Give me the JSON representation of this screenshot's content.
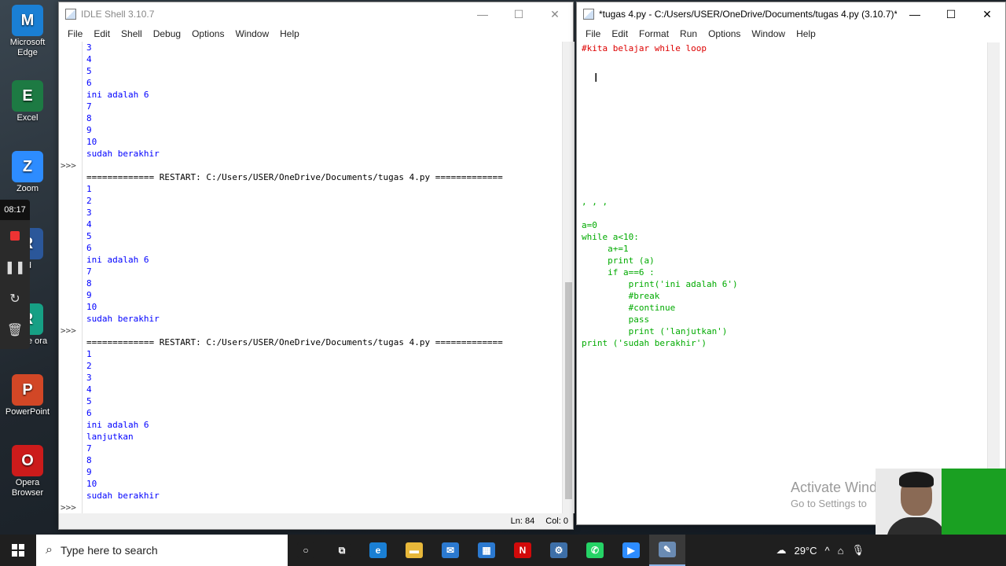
{
  "desktop": {
    "icons": [
      {
        "label": "Microsoft Edge",
        "icon": "edge-icon",
        "color": "#1a7fd4"
      },
      {
        "label": "Excel",
        "icon": "excel-icon",
        "color": "#1d7a43"
      },
      {
        "label": "Zoom",
        "icon": "zoom-icon",
        "color": "#2d8cff"
      },
      {
        "label": "rd",
        "icon": "word-icon",
        "color": "#2b579a"
      },
      {
        "label": "rshare ora",
        "icon": "filmora-icon",
        "color": "#16a085"
      },
      {
        "label": "PowerPoint",
        "icon": "powerpoint-icon",
        "color": "#d24726"
      },
      {
        "label": "Opera Browser",
        "icon": "opera-icon",
        "color": "#cc1b1b"
      }
    ],
    "recorder_time": "08:17"
  },
  "shell": {
    "title": "IDLE Shell 3.10.7",
    "menu": [
      "File",
      "Edit",
      "Shell",
      "Debug",
      "Options",
      "Window",
      "Help"
    ],
    "lines": [
      {
        "p": "",
        "t": "3",
        "k": "out"
      },
      {
        "p": "",
        "t": "4",
        "k": "out"
      },
      {
        "p": "",
        "t": "5",
        "k": "out"
      },
      {
        "p": "",
        "t": "6",
        "k": "out"
      },
      {
        "p": "",
        "t": "ini adalah 6",
        "k": "out"
      },
      {
        "p": "",
        "t": "7",
        "k": "out"
      },
      {
        "p": "",
        "t": "8",
        "k": "out"
      },
      {
        "p": "",
        "t": "9",
        "k": "out"
      },
      {
        "p": "",
        "t": "10",
        "k": "out"
      },
      {
        "p": "",
        "t": "sudah berakhir",
        "k": "out"
      },
      {
        "p": ">>>",
        "t": "",
        "k": "out"
      },
      {
        "p": "",
        "t": "============= RESTART: C:/Users/USER/OneDrive/Documents/tugas 4.py =============",
        "k": "restart"
      },
      {
        "p": "",
        "t": "1",
        "k": "out"
      },
      {
        "p": "",
        "t": "2",
        "k": "out"
      },
      {
        "p": "",
        "t": "3",
        "k": "out"
      },
      {
        "p": "",
        "t": "4",
        "k": "out"
      },
      {
        "p": "",
        "t": "5",
        "k": "out"
      },
      {
        "p": "",
        "t": "6",
        "k": "out"
      },
      {
        "p": "",
        "t": "ini adalah 6",
        "k": "out"
      },
      {
        "p": "",
        "t": "7",
        "k": "out"
      },
      {
        "p": "",
        "t": "8",
        "k": "out"
      },
      {
        "p": "",
        "t": "9",
        "k": "out"
      },
      {
        "p": "",
        "t": "10",
        "k": "out"
      },
      {
        "p": "",
        "t": "sudah berakhir",
        "k": "out"
      },
      {
        "p": ">>>",
        "t": "",
        "k": "out"
      },
      {
        "p": "",
        "t": "============= RESTART: C:/Users/USER/OneDrive/Documents/tugas 4.py =============",
        "k": "restart"
      },
      {
        "p": "",
        "t": "1",
        "k": "out"
      },
      {
        "p": "",
        "t": "2",
        "k": "out"
      },
      {
        "p": "",
        "t": "3",
        "k": "out"
      },
      {
        "p": "",
        "t": "4",
        "k": "out"
      },
      {
        "p": "",
        "t": "5",
        "k": "out"
      },
      {
        "p": "",
        "t": "6",
        "k": "out"
      },
      {
        "p": "",
        "t": "ini adalah 6",
        "k": "out"
      },
      {
        "p": "",
        "t": "lanjutkan",
        "k": "out"
      },
      {
        "p": "",
        "t": "7",
        "k": "out"
      },
      {
        "p": "",
        "t": "8",
        "k": "out"
      },
      {
        "p": "",
        "t": "9",
        "k": "out"
      },
      {
        "p": "",
        "t": "10",
        "k": "out"
      },
      {
        "p": "",
        "t": "sudah berakhir",
        "k": "out"
      },
      {
        "p": ">>>",
        "t": "",
        "k": "out"
      }
    ],
    "status_ln": "Ln: 84",
    "status_col": "Col: 0"
  },
  "editor": {
    "title": "*tugas 4.py - C:/Users/USER/OneDrive/Documents/tugas 4.py (3.10.7)*",
    "menu": [
      "File",
      "Edit",
      "Format",
      "Run",
      "Options",
      "Window",
      "Help"
    ],
    "lines": [
      {
        "t": "#kita belajar while loop",
        "k": "cmt"
      },
      {
        "t": "",
        "k": "code"
      },
      {
        "t": "",
        "k": "code"
      },
      {
        "t": "",
        "k": "code"
      },
      {
        "t": "",
        "k": "code"
      },
      {
        "t": "",
        "k": "code"
      },
      {
        "t": "",
        "k": "code"
      },
      {
        "t": "",
        "k": "code"
      },
      {
        "t": "",
        "k": "code"
      },
      {
        "t": "",
        "k": "code"
      },
      {
        "t": "",
        "k": "code"
      },
      {
        "t": "",
        "k": "code"
      },
      {
        "t": "",
        "k": "code"
      },
      {
        "t": ", , ,",
        "k": "code"
      },
      {
        "t": "",
        "k": "code"
      },
      {
        "t": "a=0",
        "k": "code"
      },
      {
        "t": "while a<10:",
        "k": "code"
      },
      {
        "t": "     a+=1",
        "k": "code"
      },
      {
        "t": "     print (a)",
        "k": "code"
      },
      {
        "t": "     if a==6 :",
        "k": "code"
      },
      {
        "t": "         print('ini adalah 6')",
        "k": "code"
      },
      {
        "t": "         #break",
        "k": "code"
      },
      {
        "t": "         #continue",
        "k": "code"
      },
      {
        "t": "         pass",
        "k": "code"
      },
      {
        "t": "         print ('lanjutkan')",
        "k": "code"
      },
      {
        "t": "print ('sudah berakhir')",
        "k": "code"
      }
    ]
  },
  "watermark": {
    "line1": "Activate Wind",
    "line2": "Go to Settings to"
  },
  "taskbar": {
    "search_placeholder": "Type here to search",
    "weather": "29°C",
    "apps": [
      {
        "name": "cortana-icon",
        "glyph": "○",
        "color": "#1f1f1f"
      },
      {
        "name": "task-view-icon",
        "glyph": "⧉",
        "color": "#1f1f1f"
      },
      {
        "name": "edge-taskbar-icon",
        "glyph": "e",
        "color": "#1a7fd4"
      },
      {
        "name": "file-explorer-icon",
        "glyph": "▬",
        "color": "#e8b83a"
      },
      {
        "name": "mail-icon",
        "glyph": "✉",
        "color": "#2b79d0"
      },
      {
        "name": "store-icon",
        "glyph": "▦",
        "color": "#2b79d0"
      },
      {
        "name": "netflix-icon",
        "glyph": "N",
        "color": "#d20a0a"
      },
      {
        "name": "python-icon",
        "glyph": "⚙",
        "color": "#3d6fa8"
      },
      {
        "name": "whatsapp-icon",
        "glyph": "✆",
        "color": "#25d366"
      },
      {
        "name": "zoom-taskbar-icon",
        "glyph": "▶",
        "color": "#2d8cff"
      },
      {
        "name": "idle-taskbar-icon",
        "glyph": "✎",
        "color": "#6a8bb3"
      }
    ]
  }
}
